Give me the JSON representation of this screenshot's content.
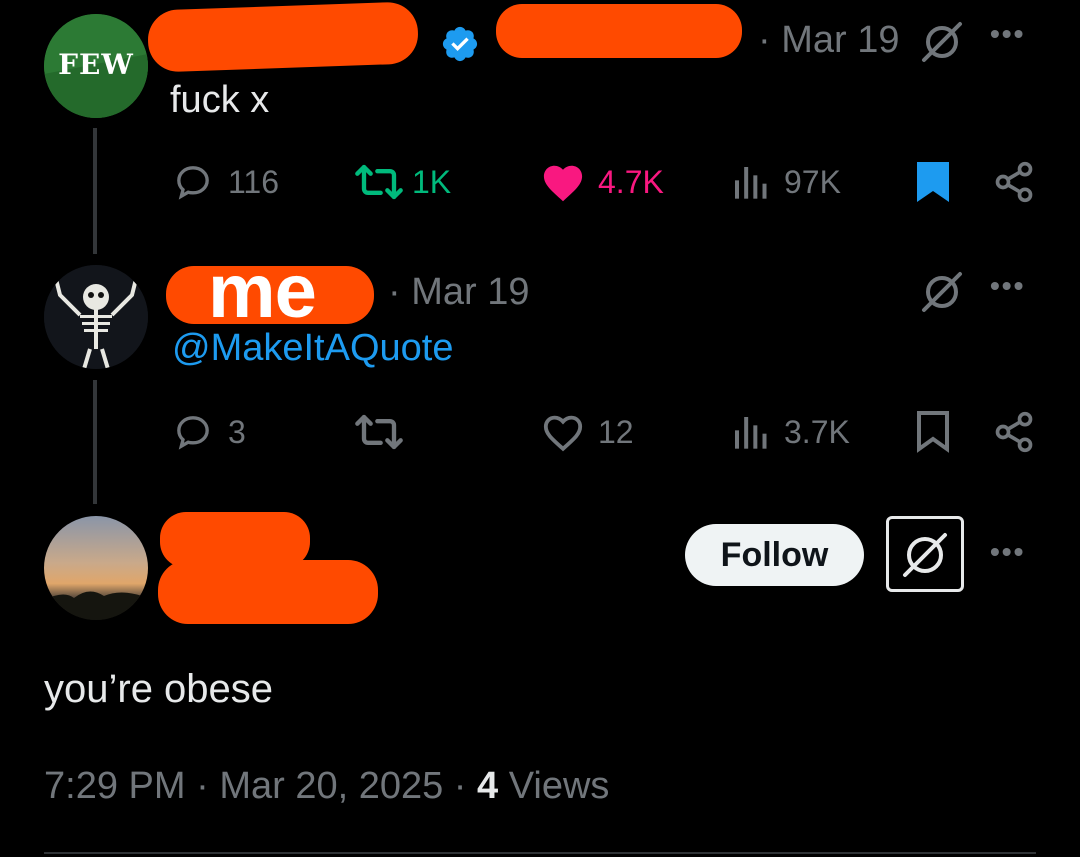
{
  "colors": {
    "background": "#000000",
    "text": "#e7e9ea",
    "muted": "#71767b",
    "link": "#1d9bf0",
    "like": "#f91880",
    "retweet": "#00ba7c",
    "redaction": "#ff4a00"
  },
  "tweet1": {
    "avatar_text": "FEW",
    "date": "· Mar 19",
    "text": "fuck x",
    "replies": "116",
    "retweets": "1K",
    "likes": "4.7K",
    "views": "97K",
    "icons": [
      "verified-badge-icon",
      "grok-icon",
      "more-icon",
      "reply-icon",
      "retweet-icon",
      "like-filled-icon",
      "views-icon",
      "bookmark-filled-icon",
      "share-icon"
    ]
  },
  "tweet2": {
    "name_overlay": "me",
    "date": "· Mar 19",
    "text": "@MakeItAQuote",
    "replies": "3",
    "likes": "12",
    "views": "3.7K",
    "icons": [
      "grok-icon",
      "more-icon",
      "reply-icon",
      "retweet-icon",
      "like-icon",
      "views-icon",
      "bookmark-icon",
      "share-icon"
    ]
  },
  "tweet3": {
    "follow_label": "Follow",
    "text": "you’re obese",
    "time": "7:29 PM",
    "date": "Mar 20, 2025",
    "sep": "·",
    "views_count": "4",
    "views_label": "Views",
    "icons": [
      "grok-icon",
      "more-icon"
    ]
  }
}
